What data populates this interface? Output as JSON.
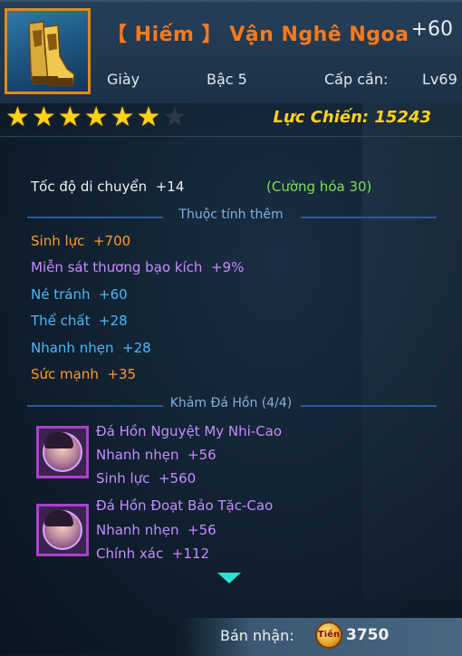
{
  "item": {
    "title": "【 Hiếm 】 Vận Nghê Ngoa",
    "enhance": "+60",
    "type": "Giày",
    "tier": "Bậc 5",
    "req_label": "Cấp cần:",
    "req_level": "Lv69",
    "stars_total": 7,
    "stars_filled": 6,
    "power": "Lực Chiến: 15243",
    "icon": "boots-icon"
  },
  "base_stat": {
    "name": "Tốc độ di chuyển",
    "value": "+14",
    "enhance_note": "(Cường hóa 30)"
  },
  "extra_section_label": "Thuộc tính thêm",
  "extra_stats": [
    {
      "name": "Sinh lực",
      "value": "+700",
      "color": "#ff9a2a"
    },
    {
      "name": "Miễn sát thương bạo kích",
      "value": "+9%",
      "color": "#c58cff"
    },
    {
      "name": "Né tránh",
      "value": "+60",
      "color": "#4ab8ff"
    },
    {
      "name": "Thể chất",
      "value": "+28",
      "color": "#4ab8ff"
    },
    {
      "name": "Nhanh nhẹn",
      "value": "+28",
      "color": "#4ab8ff"
    },
    {
      "name": "Sức mạnh",
      "value": "+35",
      "color": "#ff9a2a"
    }
  ],
  "gem_section_label": "Khảm Đá Hồn (4/4)",
  "gems": [
    {
      "name": "Đá Hồn Nguyệt My Nhi-Cao",
      "stats": [
        {
          "name": "Nhanh nhẹn",
          "value": "+56"
        },
        {
          "name": "Sinh lực",
          "value": "+560"
        }
      ]
    },
    {
      "name": "Đá Hồn Đoạt Bảo Tặc-Cao",
      "stats": [
        {
          "name": "Nhanh nhẹn",
          "value": "+56"
        },
        {
          "name": "Chính xác",
          "value": "+112"
        }
      ]
    }
  ],
  "sell": {
    "label": "Bán nhận:",
    "value": "3750",
    "coin_text": "Tiền",
    "coin_icon": "gold-coin-icon"
  }
}
